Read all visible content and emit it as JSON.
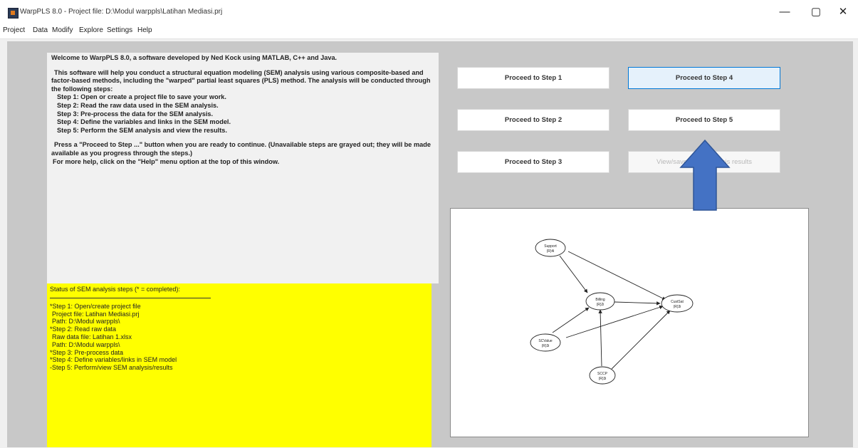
{
  "window": {
    "title": "WarpPLS 8.0 - Project file: D:\\Modul warppls\\Latihan Mediasi.prj",
    "minimize_glyph": "—",
    "maximize_glyph": "▢",
    "close_glyph": "✕"
  },
  "menu": [
    "Project",
    "Data",
    "Modify",
    "Explore",
    "Settings",
    "Help"
  ],
  "welcome": {
    "intro": "Welcome to WarpPLS 8.0, a software developed by Ned Kock using MATLAB, C++ and Java.",
    "description": "This software will help you conduct a structural equation modeling (SEM) analysis using various composite-based and factor-based methods, including the \"warped\" partial least squares (PLS) method. The analysis will be conducted through the following steps:",
    "steps": [
      "Step 1: Open or create a project file to save your work.",
      "Step 2: Read the raw data used in the SEM analysis.",
      "Step 3: Pre-process the data for the SEM analysis.",
      "Step 4: Define the variables and links in the SEM model.",
      "Step 5: Perform the SEM analysis and view the results."
    ],
    "instruction": "Press a \"Proceed to Step ...\" button when you are ready to continue. (Unavailable steps are grayed out; they will be made available as you progress through the steps.)",
    "help_hint": "For more help, click on the \"Help\" menu option at the top of this window."
  },
  "status": {
    "heading": "Status of SEM analysis steps (* = completed):",
    "lines": [
      "*Step 1: Open/create project file",
      " Project file: Latihan Mediasi.prj",
      " Path: D:\\Modul warppls\\",
      "*Step 2: Read raw data",
      " Raw data file: Latihan 1.xlsx",
      " Path: D:\\Modul warppls\\",
      "*Step 3: Pre-process data",
      "*Step 4: Define variables/links in SEM model",
      "-Step 5: Perform/view SEM analysis/results"
    ]
  },
  "buttons": {
    "step1": "Proceed to Step 1",
    "step2": "Proceed to Step 2",
    "step3": "Proceed to Step 3",
    "step4": "Proceed to Step 4",
    "step5": "Proceed to Step 5",
    "view_results": "View/save SEM analysis results"
  },
  "model": {
    "nodes": {
      "support": {
        "name": "Support",
        "meta": "(R)4i"
      },
      "billing": {
        "name": "Billing",
        "meta": "(R)2i"
      },
      "cust": {
        "name": "CustSat",
        "meta": "(R)3i"
      },
      "service": {
        "name": "SCValue",
        "meta": "(R)3i"
      },
      "price": {
        "name": "SCCP",
        "meta": "(R)3i"
      }
    }
  },
  "colors": {
    "status_bg": "#ffff00",
    "arrow_fill": "#4472c4",
    "arrow_stroke": "#2f5597",
    "active_border": "#0078d7"
  }
}
